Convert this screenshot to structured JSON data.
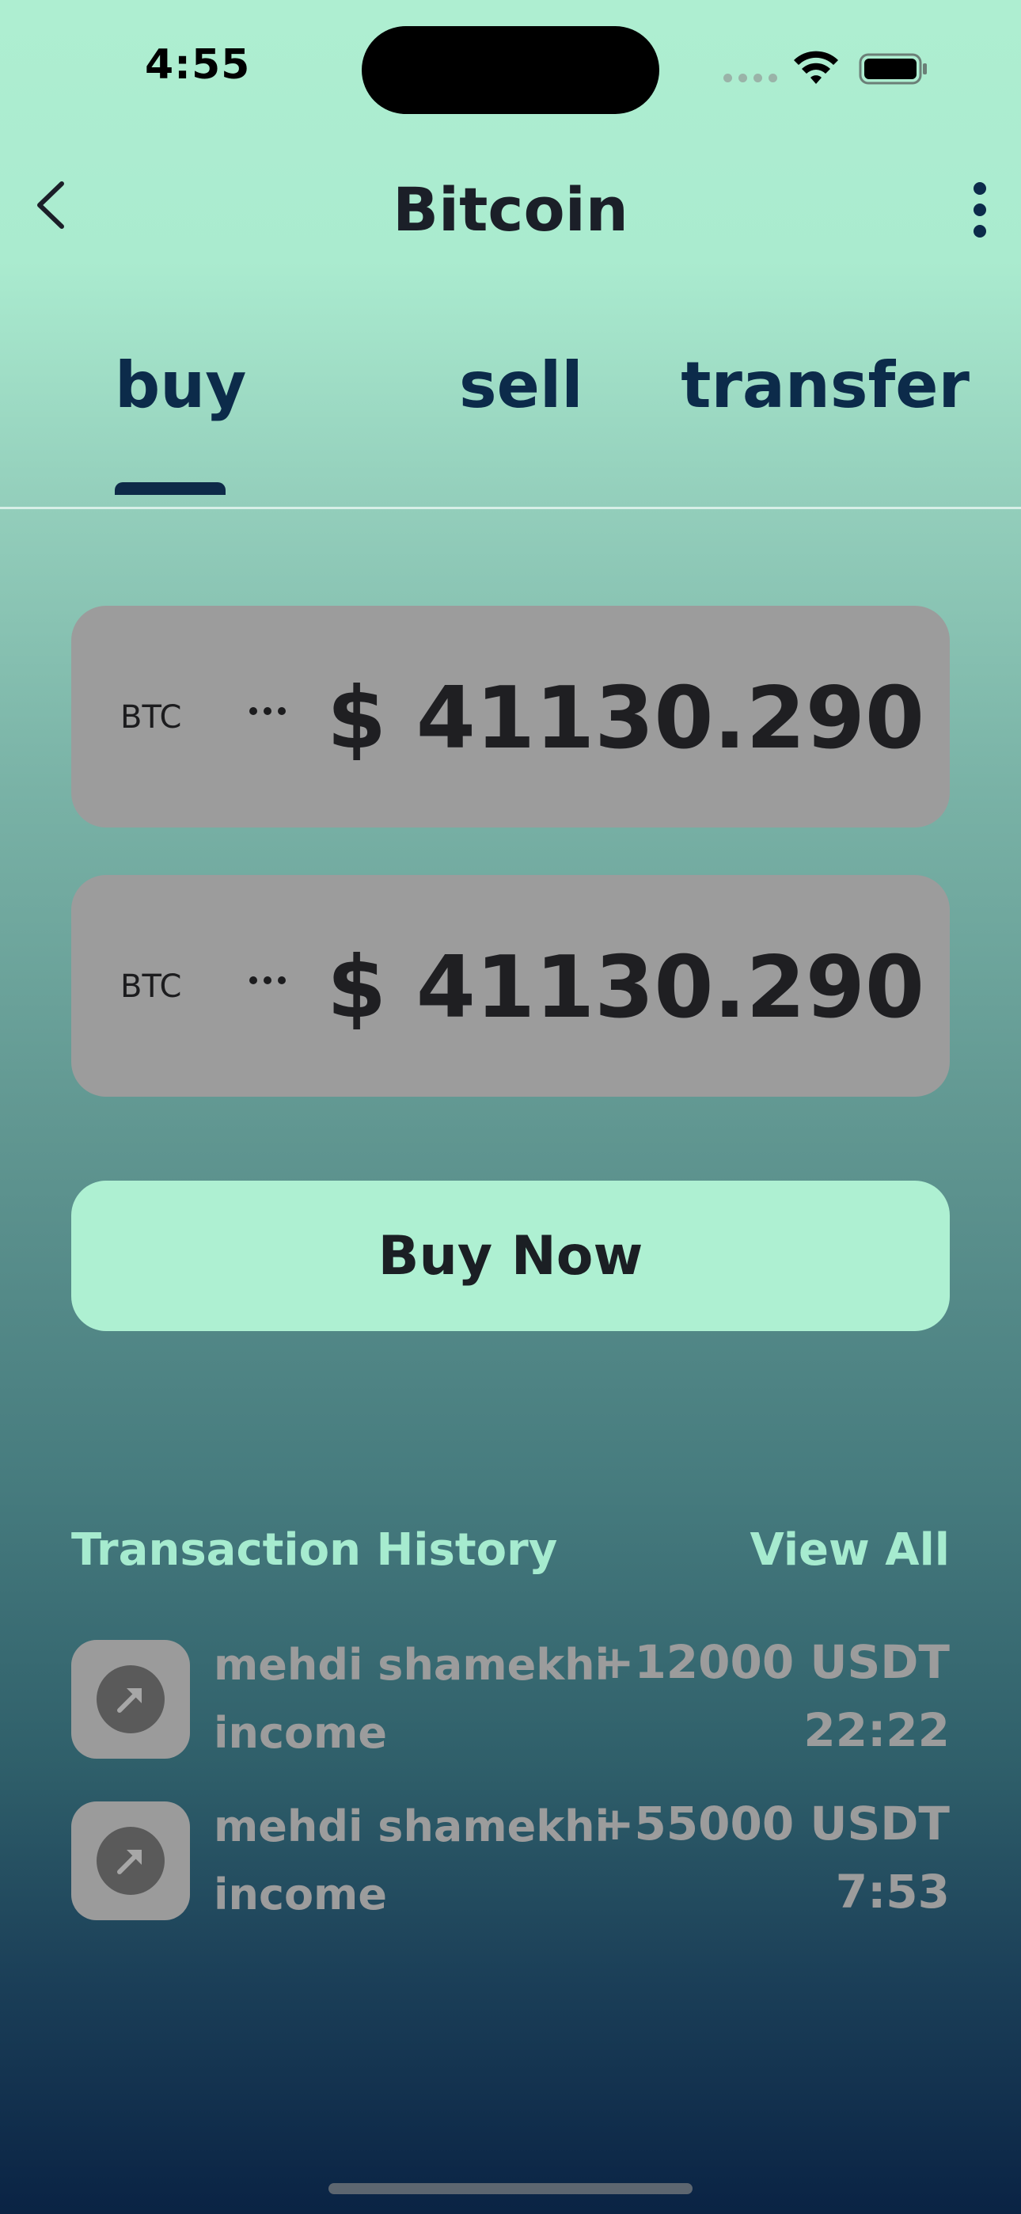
{
  "status_bar": {
    "time": "4:55",
    "icons": [
      "signal-icon",
      "wifi-icon",
      "battery-icon"
    ]
  },
  "header": {
    "title": "Bitcoin",
    "back_icon": "chevron-left-icon",
    "menu_icon": "more-vertical-icon"
  },
  "tabs": [
    {
      "label": "buy",
      "active": true
    },
    {
      "label": "sell",
      "active": false
    },
    {
      "label": "transfer",
      "active": false
    }
  ],
  "price_cards": [
    {
      "symbol": "BTC",
      "amount": "$ 41130.290"
    },
    {
      "symbol": "BTC",
      "amount": "$ 41130.290"
    }
  ],
  "buy_button": {
    "label": "Buy Now"
  },
  "history": {
    "title": "Transaction History",
    "view_all": "View All",
    "items": [
      {
        "name": "mehdi shamekhi",
        "type": "income",
        "amount": "+12000 USDT",
        "time": "22:22",
        "icon": "arrow-up-right-icon"
      },
      {
        "name": "mehdi shamekhi",
        "type": "income",
        "amount": "+55000 USDT",
        "time": "7:53",
        "icon": "arrow-up-right-icon"
      }
    ]
  },
  "colors": {
    "accent": "#aef0d2",
    "tab_text": "#0c2b4a",
    "card_bg": "#9c9c9c",
    "background_top": "#aeeed1",
    "background_bottom": "#0a2344"
  }
}
